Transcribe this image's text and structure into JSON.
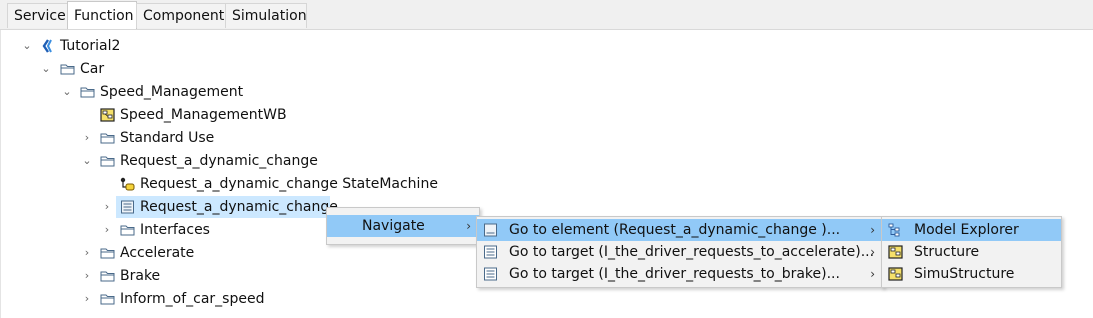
{
  "tabs": [
    "Service",
    "Function",
    "Component",
    "Simulation"
  ],
  "active_tab": "Function",
  "tree": {
    "root": "Tutorial2",
    "car": "Car",
    "speed_management": "Speed_Management",
    "speed_management_wb": "Speed_ManagementWB",
    "standard_use": "Standard Use",
    "request_folder": "Request_a_dynamic_change",
    "state_machine": "Request_a_dynamic_change StateMachine",
    "request_block": "Request_a_dynamic_change",
    "interfaces": "Interfaces",
    "accelerate": "Accelerate",
    "brake": "Brake",
    "inform": "Inform_of_car_speed"
  },
  "context_menu": {
    "navigate": "Navigate"
  },
  "navigate_submenu": {
    "items": [
      "Go to element (Request_a_dynamic_change )...",
      "Go to target (I_the_driver_requests_to_accelerate)...",
      "Go to target (I_the_driver_requests_to_brake)..."
    ]
  },
  "goto_submenu": {
    "items": [
      "Model Explorer",
      "Structure",
      "SimuStructure"
    ]
  },
  "colors": {
    "selection": "#cce8ff",
    "menu_highlight": "#91c9f7",
    "menu_bg": "#f2f2f2"
  }
}
